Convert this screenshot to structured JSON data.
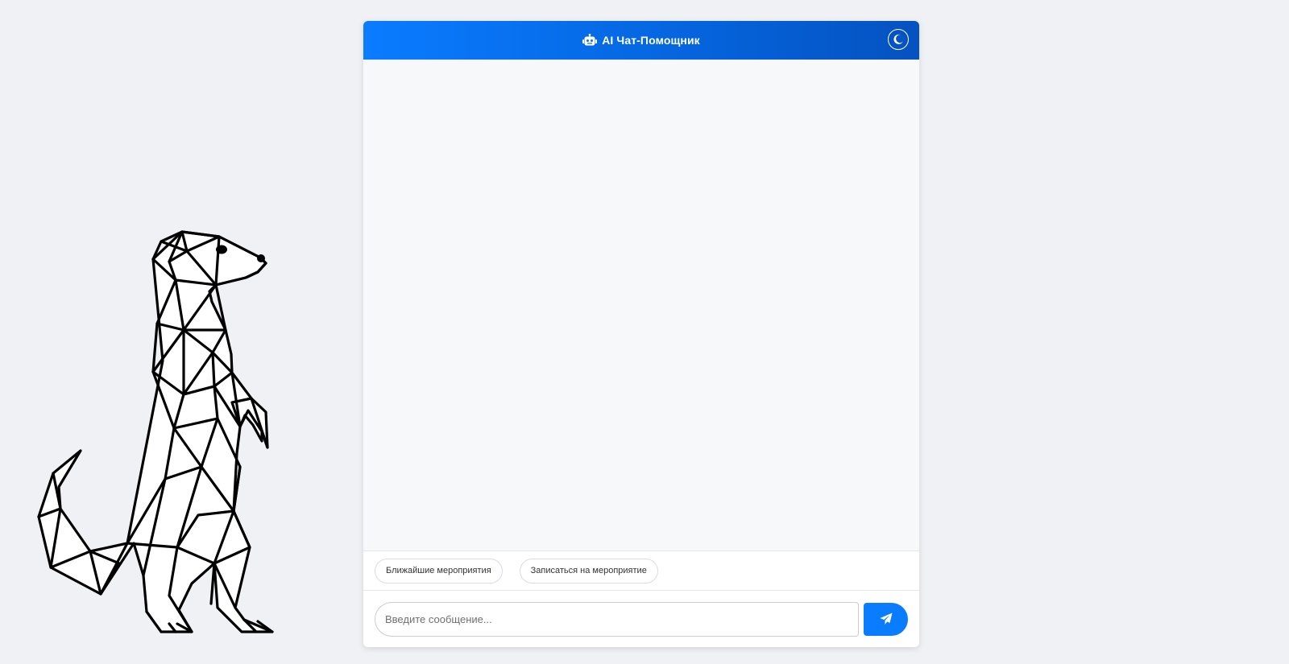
{
  "header": {
    "title": "AI Чат-Помощник",
    "icon": "robot-icon",
    "theme_toggle_icon": "moon-icon"
  },
  "quick_replies": [
    {
      "label": "Ближайшие мероприятия"
    },
    {
      "label": "Записаться на мероприятие"
    }
  ],
  "input": {
    "placeholder": "Введите сообщение...",
    "value": ""
  },
  "send_button": {
    "icon": "paper-plane-icon"
  },
  "decoration": {
    "illustration": "geometric-meerkat"
  },
  "colors": {
    "accent": "#0a7cff",
    "header_gradient_end": "#0552c0",
    "page_background": "#f0f1f5",
    "messages_background": "#f7f8fa"
  }
}
